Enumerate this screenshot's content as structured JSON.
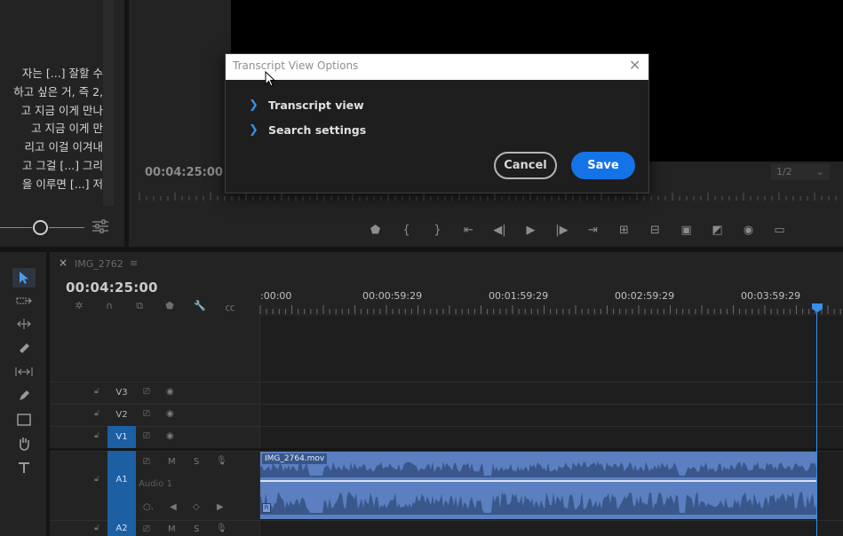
{
  "transcript": {
    "lines": [
      "자는 [...] 잘할 수",
      "하고 싶은 거, 즉 2,",
      "고 지금 이게 만나",
      "고 지금 이게 만",
      "리고 이걸 이겨내",
      "고 그걸 [...] 그리",
      "을 이루면 [...] 저"
    ]
  },
  "monitor": {
    "timecode": "00:04:25:00",
    "fit": "1/2",
    "controls": [
      "marker-icon",
      "in-point-icon",
      "out-point-icon",
      "go-to-in-icon",
      "step-back-icon",
      "play-icon",
      "step-forward-icon",
      "go-to-out-icon",
      "lift-icon",
      "extract-icon",
      "insert-icon",
      "overwrite-icon",
      "export-frame-icon",
      "safe-margins-icon"
    ]
  },
  "sequence": {
    "close": "×",
    "name": "IMG_2762",
    "menu": "≡",
    "timecode": "00:04:25:00",
    "ruler_labels": [
      ":00:00",
      "00:00:59:29",
      "00:01:59:29",
      "00:02:59:29",
      "00:03:59:29"
    ]
  },
  "tracks": {
    "video": [
      {
        "name": "V3",
        "active": false
      },
      {
        "name": "V2",
        "active": false
      },
      {
        "name": "V1",
        "active": true
      }
    ],
    "audio": [
      {
        "name": "A1",
        "label": "Audio 1",
        "active": true
      },
      {
        "name": "A2",
        "active": true
      }
    ],
    "mute_label": "M",
    "solo_label": "S"
  },
  "clip": {
    "name": "IMG_2764.mov",
    "fx_label": "R"
  },
  "dialog": {
    "title": "Transcript View Options",
    "sections": [
      "Transcript view",
      "Search settings"
    ],
    "cancel": "Cancel",
    "save": "Save"
  },
  "colors": {
    "accent_blue": "#1473e6",
    "clip_audio": "#5b7fc0",
    "track_active": "#1d5fa3",
    "playhead": "#3a8ee6"
  }
}
